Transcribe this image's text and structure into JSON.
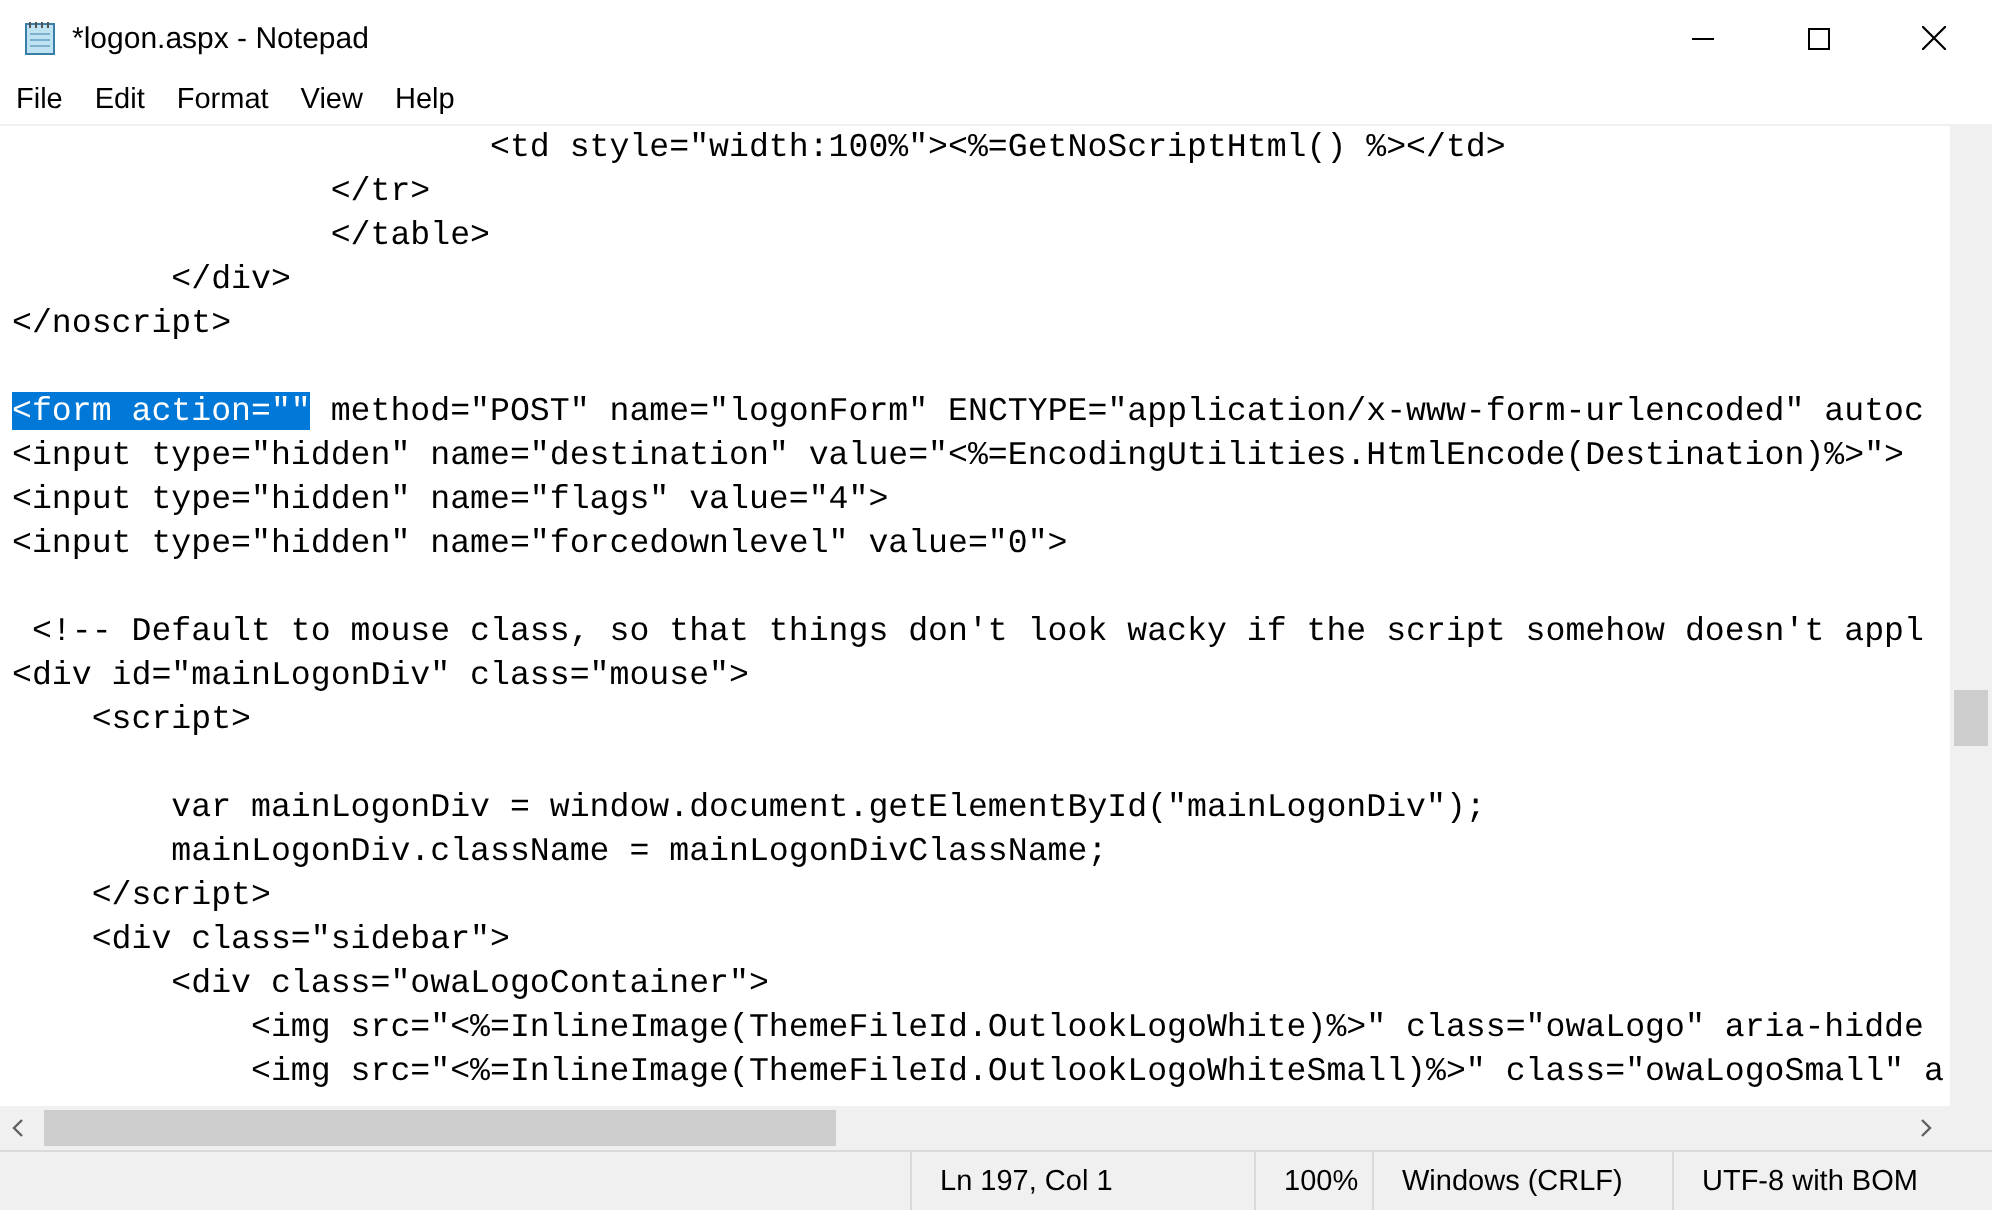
{
  "window": {
    "title": "*logon.aspx - Notepad"
  },
  "menu": [
    "File",
    "Edit",
    "Format",
    "View",
    "Help"
  ],
  "editor": {
    "lines": [
      {
        "segments": [
          {
            "text": "                        <td style=\"width:100%\"><%=GetNoScriptHtml() %></td>",
            "selected": false
          }
        ]
      },
      {
        "segments": [
          {
            "text": "                </tr>",
            "selected": false
          }
        ]
      },
      {
        "segments": [
          {
            "text": "                </table>",
            "selected": false
          }
        ]
      },
      {
        "segments": [
          {
            "text": "        </div>",
            "selected": false
          }
        ]
      },
      {
        "segments": [
          {
            "text": "</noscript>",
            "selected": false
          }
        ]
      },
      {
        "kind": "blank"
      },
      {
        "segments": [
          {
            "text": "<form action=\"\"",
            "selected": true
          },
          {
            "text": " method=\"POST\" name=\"logonForm\" ENCTYPE=\"application/x-www-form-urlencoded\" autoc",
            "selected": false
          }
        ]
      },
      {
        "segments": [
          {
            "text": "<input type=\"hidden\" name=\"destination\" value=\"<%=EncodingUtilities.HtmlEncode(Destination)%>\">",
            "selected": false
          }
        ]
      },
      {
        "segments": [
          {
            "text": "<input type=\"hidden\" name=\"flags\" value=\"4\">",
            "selected": false
          }
        ]
      },
      {
        "segments": [
          {
            "text": "<input type=\"hidden\" name=\"forcedownlevel\" value=\"0\">",
            "selected": false
          }
        ]
      },
      {
        "kind": "blank"
      },
      {
        "segments": [
          {
            "text": " <!-- Default to mouse class, so that things don't look wacky if the script somehow doesn't appl",
            "selected": false
          }
        ]
      },
      {
        "segments": [
          {
            "text": "<div id=\"mainLogonDiv\" class=\"mouse\">",
            "selected": false
          }
        ]
      },
      {
        "segments": [
          {
            "text": "    <script>",
            "selected": false
          }
        ]
      },
      {
        "kind": "blank"
      },
      {
        "segments": [
          {
            "text": "        var mainLogonDiv = window.document.getElementById(\"mainLogonDiv\");",
            "selected": false
          }
        ]
      },
      {
        "segments": [
          {
            "text": "        mainLogonDiv.className = mainLogonDivClassName;",
            "selected": false
          }
        ]
      },
      {
        "segments": [
          {
            "text": "    </script>",
            "selected": false
          }
        ]
      },
      {
        "segments": [
          {
            "text": "    <div class=\"sidebar\">",
            "selected": false
          }
        ]
      },
      {
        "segments": [
          {
            "text": "        <div class=\"owaLogoContainer\">",
            "selected": false
          }
        ]
      },
      {
        "segments": [
          {
            "text": "            <img src=\"<%=InlineImage(ThemeFileId.OutlookLogoWhite)%>\" class=\"owaLogo\" aria-hidde",
            "selected": false
          }
        ]
      },
      {
        "segments": [
          {
            "text": "            <img src=\"<%=InlineImage(ThemeFileId.OutlookLogoWhiteSmall)%>\" class=\"owaLogoSmall\" a",
            "selected": false
          }
        ]
      }
    ]
  },
  "status_bar": [
    "Ln 197, Col 1",
    "100%",
    "Windows (CRLF)",
    "UTF-8 with BOM"
  ]
}
